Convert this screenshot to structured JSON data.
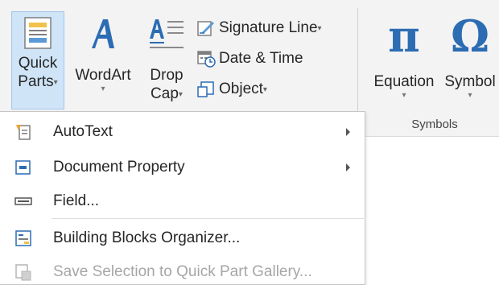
{
  "ribbon": {
    "quick_parts": {
      "line1": "Quick",
      "line2": "Parts"
    },
    "wordart": {
      "label": "WordArt"
    },
    "drop_cap": {
      "line1": "Drop",
      "line2": "Cap"
    },
    "signature_line": {
      "label": "Signature Line"
    },
    "date_time": {
      "label": "Date & Time"
    },
    "object": {
      "label": "Object"
    },
    "equation": {
      "label": "Equation",
      "glyph": "π"
    },
    "symbol": {
      "label": "Symbol",
      "glyph": "Ω"
    },
    "symbols_group": {
      "label": "Symbols"
    }
  },
  "menu": {
    "items": [
      {
        "label": "AutoText",
        "has_submenu": true,
        "enabled": true
      },
      {
        "label": "Document Property",
        "has_submenu": true,
        "enabled": true
      },
      {
        "label": "Field...",
        "has_submenu": false,
        "enabled": true
      },
      {
        "label": "Building Blocks Organizer...",
        "has_submenu": false,
        "enabled": true
      },
      {
        "label": "Save Selection to Quick Part Gallery...",
        "has_submenu": false,
        "enabled": false
      }
    ]
  },
  "colors": {
    "selected_button": "#cfe4f7",
    "accent_blue": "#2b6cb3",
    "disabled_text": "#a6a6a6"
  }
}
